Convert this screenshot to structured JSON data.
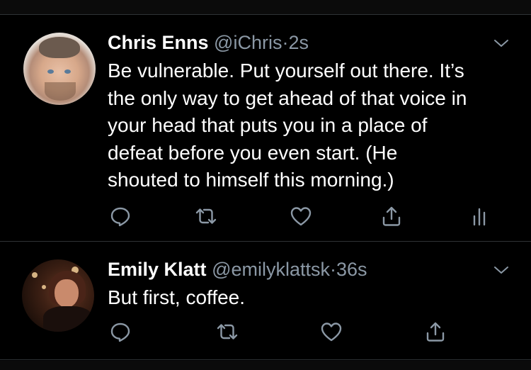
{
  "colors": {
    "background": "#000000",
    "text": "#ffffff",
    "secondary": "#8b98a5",
    "divider": "#2f3336"
  },
  "tweets": [
    {
      "display_name": "Chris Enns",
      "handle": "@iChris",
      "separator": "·",
      "time": "2s",
      "text": "Be vulnerable. Put yourself out there. It’s\nthe only way to get ahead of that voice in\nyour head that puts you in a place of\ndefeat before you even start. (He\nshouted to himself this morning.)",
      "avatar": "avatar-photo",
      "caret_icon": "chevron-down-icon",
      "actions": [
        "reply-icon",
        "retweet-icon",
        "like-icon",
        "share-icon",
        "analytics-icon"
      ]
    },
    {
      "display_name": "Emily Klatt",
      "handle": "@emilyklattsk",
      "separator": "·",
      "time": "36s",
      "text": "But first, coffee.",
      "avatar": "avatar-photo",
      "caret_icon": "chevron-down-icon",
      "actions": [
        "reply-icon",
        "retweet-icon",
        "like-icon",
        "share-icon"
      ]
    }
  ]
}
